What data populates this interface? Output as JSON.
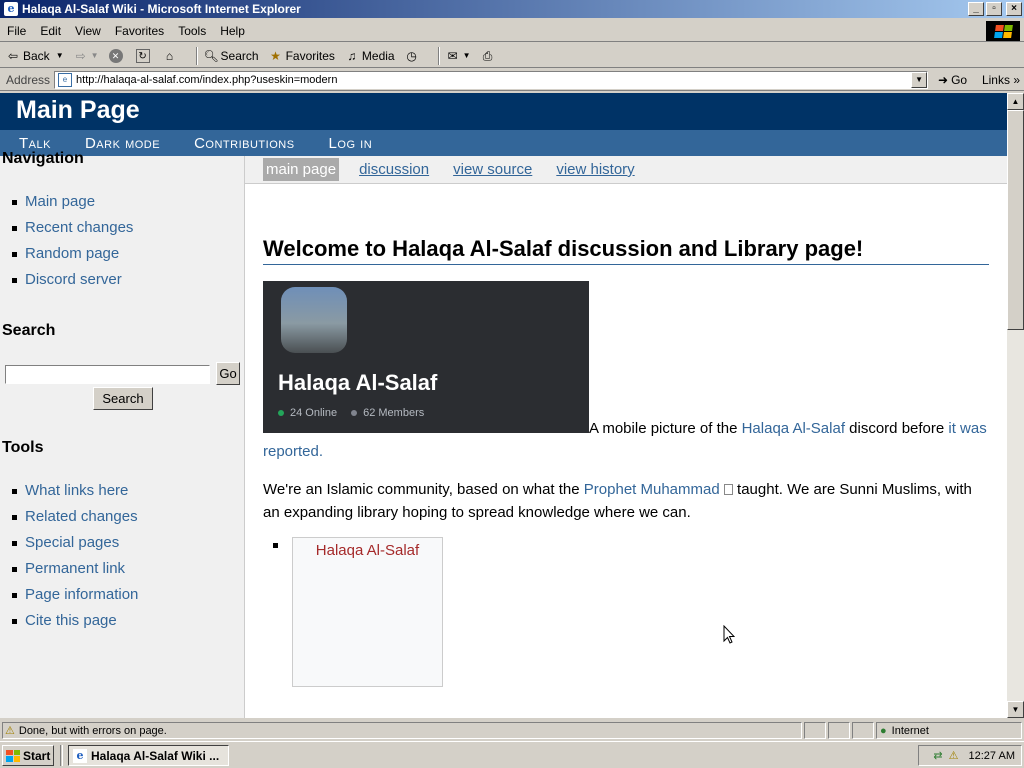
{
  "window": {
    "title": "Halaqa Al-Salaf Wiki - Microsoft Internet Explorer",
    "min_glyph": "_",
    "max_glyph": "▫",
    "close_glyph": "×"
  },
  "menu": [
    "File",
    "Edit",
    "View",
    "Favorites",
    "Tools",
    "Help"
  ],
  "toolbar": {
    "back": "Back",
    "search": "Search",
    "favorites": "Favorites",
    "media": "Media"
  },
  "address": {
    "label": "Address",
    "url": "http://halaqa-al-salaf.com/index.php?useskin=modern",
    "go": "Go",
    "links": "Links"
  },
  "wiki": {
    "site_title": "Main Page",
    "nav": [
      "Talk",
      "Dark mode",
      "Contributions",
      "Log in"
    ],
    "tabs": [
      "main page",
      "discussion",
      "view source",
      "view history"
    ],
    "navigation_heading": "Navigation",
    "navigation": [
      "Main page",
      "Recent changes",
      "Random page",
      "Discord server"
    ],
    "search_heading": "Search",
    "search_go": "Go",
    "search_button": "Search",
    "tools_heading": "Tools",
    "tools": [
      "What links here",
      "Related changes",
      "Special pages",
      "Permanent link",
      "Page information",
      "Cite this page"
    ],
    "page_heading": "Welcome to Halaqa Al-Salaf discussion and Library page!",
    "discord": {
      "name": "Halaqa Al-Salaf",
      "online": "24 Online",
      "members": "62 Members",
      "online_color": "#23a55a",
      "members_color": "#80848e"
    },
    "caption": {
      "before": "A mobile picture of the ",
      "link1": "Halaqa Al-Salaf",
      "middle": " discord before ",
      "link2": "it was reported."
    },
    "paragraph": {
      "before": "We're an Islamic community, based on what the ",
      "link": "Prophet Muhammad ",
      "after": " taught. We are Sunni Muslims, with an expanding library hoping to spread knowledge where we can."
    },
    "gallery_label": "Halaqa Al-Salaf"
  },
  "status": {
    "text": "Done, but with errors on page.",
    "zone": "Internet"
  },
  "taskbar": {
    "start": "Start",
    "task": "Halaqa Al-Salaf Wiki ...",
    "clock": "12:27 AM"
  }
}
